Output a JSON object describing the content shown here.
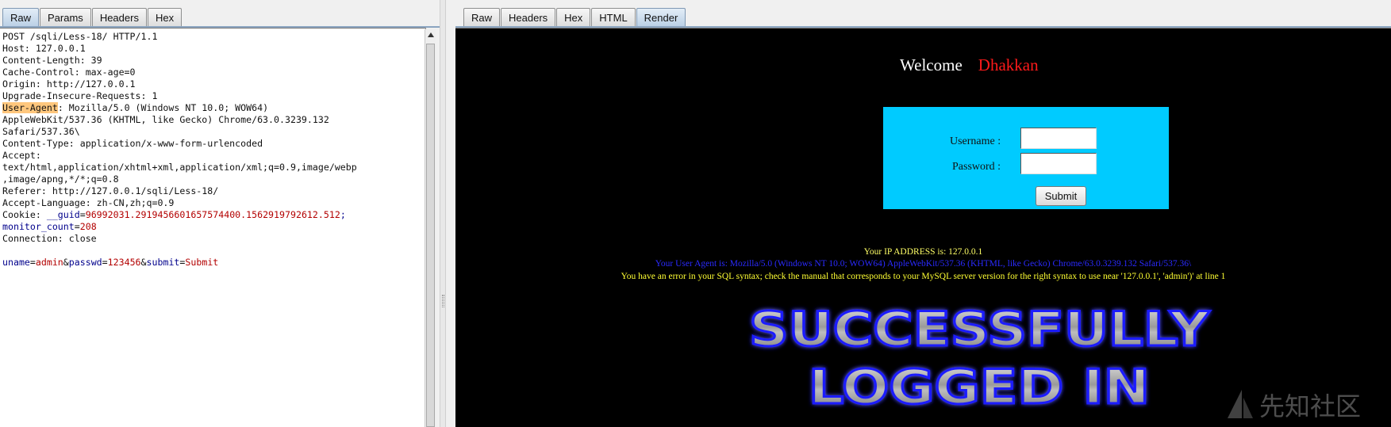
{
  "left_tabs": [
    "Raw",
    "Params",
    "Headers",
    "Hex"
  ],
  "right_tabs": [
    "Raw",
    "Headers",
    "Hex",
    "HTML",
    "Render"
  ],
  "request": {
    "line1": "POST /sqli/Less-18/ HTTP/1.1",
    "line2": "Host: 127.0.0.1",
    "line3": "Content-Length: 39",
    "line4": "Cache-Control: max-age=0",
    "line5": "Origin: http://127.0.0.1",
    "line6": "Upgrade-Insecure-Requests: 1",
    "ua_key": "User-Agent",
    "ua_value": ": Mozilla/5.0 (Windows NT 10.0; WOW64)",
    "line8": "AppleWebKit/537.36 (KHTML, like Gecko) Chrome/63.0.3239.132",
    "line9": "Safari/537.36\\",
    "line10": "Content-Type: application/x-www-form-urlencoded",
    "line11": "Accept:",
    "line12": "text/html,application/xhtml+xml,application/xml;q=0.9,image/webp",
    "line13": ",image/apng,*/*;q=0.8",
    "line14": "Referer: http://127.0.0.1/sqli/Less-18/",
    "line15": "Accept-Language: zh-CN,zh;q=0.9",
    "cookie_label": "Cookie: ",
    "cookie_guid_key": "__guid",
    "cookie_guid_value": "96992031.2919456601657574400.1562919792612.512",
    "cookie_sep": ";",
    "cookie_mc_key": "monitor_count",
    "cookie_mc_value": "208",
    "line18": "Connection: close",
    "body_uname_key": "uname",
    "body_uname_value": "admin",
    "body_pass_key": "passwd",
    "body_pass_value": "123456",
    "body_submit_key": "submit",
    "body_submit_value": "Submit",
    "eq": "=",
    "amp": "&"
  },
  "render": {
    "welcome": "Welcome",
    "name": "Dhakkan",
    "username_label": "Username :",
    "password_label": "Password :",
    "submit_label": "Submit",
    "ip_line": "Your IP ADDRESS is: 127.0.0.1",
    "ua_line": "Your User Agent is: Mozilla/5.0 (Windows NT 10.0; WOW64) AppleWebKit/537.36 (KHTML, like Gecko) Chrome/63.0.3239.132 Safari/537.36\\",
    "error_line": "You have an error in your SQL syntax; check the manual that corresponds to your MySQL server version for the right syntax to use near '127.0.0.1', 'admin')' at line 1",
    "banner_line1": "SUCCESSFULLY",
    "banner_line2": "LOGGED IN"
  },
  "watermark": "先知社区",
  "colors": {
    "welcome_name": "#ff1a1a",
    "login_box": "#00cbff",
    "ip_text": "#ffff66",
    "ua_text": "#2a2aff",
    "error_text": "#ffff33"
  }
}
